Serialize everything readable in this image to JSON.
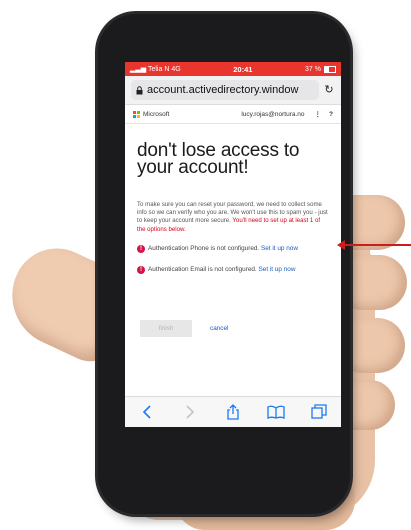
{
  "status_bar": {
    "carrier": "Telia N",
    "network": "4G",
    "time": "20:41",
    "battery": "37 %",
    "color": "#e8362e"
  },
  "browser": {
    "url": "account.activedirectory.window",
    "reload_icon": "reload-icon",
    "lock_icon": "lock-icon"
  },
  "ms_header": {
    "brand": "Microsoft",
    "user": "lucy.rojas@nortura.no",
    "menu": "⋮",
    "help": "?"
  },
  "page": {
    "title": "don't lose access to your account!",
    "intro": "To make sure you can reset your password, we need to collect some info so we can verify who you are. We won't use this to spam you - just to keep your account more secure.",
    "warning": "You'll need to set up at least 1 of the options below.",
    "methods": [
      {
        "text": "Authentication Phone is not configured.",
        "link": "Set it up now"
      },
      {
        "text": "Authentication Email is not configured.",
        "link": "Set it up now"
      }
    ],
    "finish_label": "finish",
    "cancel_label": "cancel"
  },
  "colors": {
    "accent_link": "#1a5bbf",
    "warning": "#d6001c",
    "alert_icon": "#d6124a",
    "arrow": "#c81e1e"
  },
  "toolbar_icons": [
    "back-icon",
    "forward-icon",
    "share-icon",
    "bookmarks-icon",
    "tabs-icon"
  ]
}
